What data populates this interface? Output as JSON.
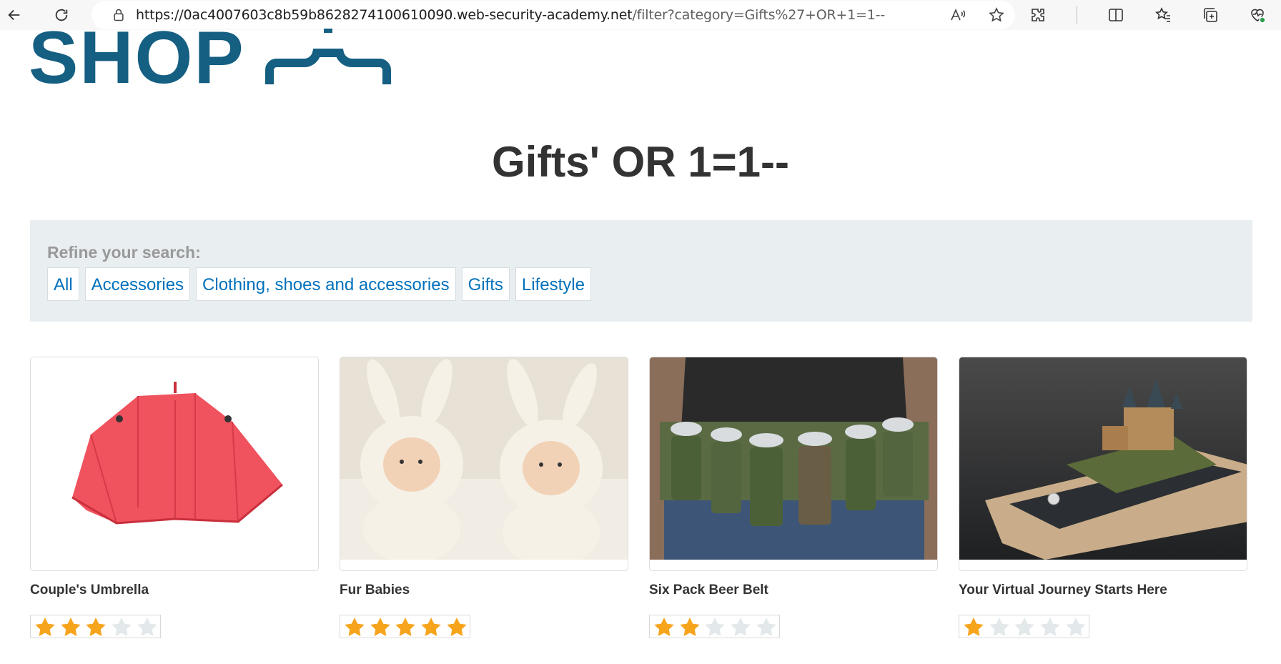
{
  "browser": {
    "url_host": "https://0ac4007603c8b59b8628274100610090.web-security-academy.net",
    "url_path": "/filter?category=Gifts%27+OR+1=1--"
  },
  "logo": {
    "text": "SHOP"
  },
  "page": {
    "title": "Gifts' OR 1=1--"
  },
  "filter": {
    "label": "Refine your search:",
    "categories": [
      "All",
      "Accessories",
      "Clothing, shoes and accessories",
      "Gifts",
      "Lifestyle"
    ]
  },
  "products": [
    {
      "name": "Couple's Umbrella",
      "rating": 3,
      "image": "red-umbrella"
    },
    {
      "name": "Fur Babies",
      "rating": 5,
      "image": "babies-in-bunny-hats"
    },
    {
      "name": "Six Pack Beer Belt",
      "rating": 2,
      "image": "beer-belt"
    },
    {
      "name": "Your Virtual Journey Starts Here",
      "rating": 1,
      "image": "castle-on-phone"
    }
  ],
  "colors": {
    "brand": "#155f82",
    "link": "#0071bc",
    "star_filled": "#f7a41d",
    "star_empty": "#e3e8eb",
    "panel_bg": "#e9eef1"
  }
}
